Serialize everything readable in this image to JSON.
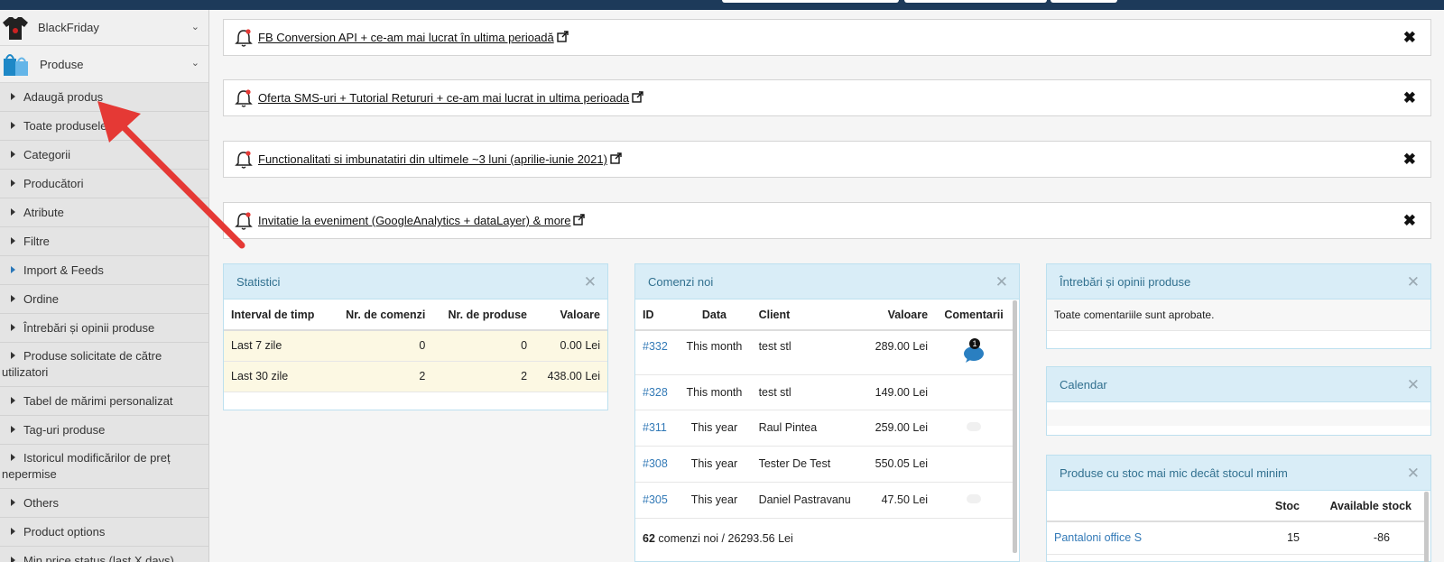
{
  "sidebar": {
    "menus": [
      {
        "label": "BlackFriday"
      },
      {
        "label": "Produse"
      }
    ],
    "items": [
      {
        "label": "Adaugă produs"
      },
      {
        "label": "Toate produsele"
      },
      {
        "label": "Categorii"
      },
      {
        "label": "Producători"
      },
      {
        "label": "Atribute"
      },
      {
        "label": "Filtre"
      },
      {
        "label": "Import & Feeds"
      },
      {
        "label": "Ordine"
      },
      {
        "label": "Întrebări și opinii produse"
      },
      {
        "label": "Produse solicitate de către utilizatori"
      },
      {
        "label": "Tabel de mărimi personalizat"
      },
      {
        "label": "Tag-uri produse"
      },
      {
        "label": "Istoricul modificărilor de preț nepermise"
      },
      {
        "label": "Others"
      },
      {
        "label": "Product options"
      },
      {
        "label": "Min price status (last X days)"
      }
    ]
  },
  "notifications": [
    {
      "text": "FB Conversion API + ce-am mai lucrat în ultima perioadă"
    },
    {
      "text": "Oferta SMS-uri + Tutorial Retururi + ce-am mai lucrat in ultima perioada"
    },
    {
      "text": "Functionalitati si imbunatatiri din ultimele ~3 luni (aprilie-iunie 2021)"
    },
    {
      "text": "Invitatie la eveniment (GoogleAnalytics + dataLayer) & more"
    }
  ],
  "stats": {
    "title": "Statistici",
    "headers": [
      "Interval de timp",
      "Nr. de comenzi",
      "Nr. de produse",
      "Valoare"
    ],
    "rows": [
      {
        "interval": "Last 7 zile",
        "orders": "0",
        "products": "0",
        "value": "0.00 Lei"
      },
      {
        "interval": "Last 30 zile",
        "orders": "2",
        "products": "2",
        "value": "438.00 Lei"
      }
    ]
  },
  "orders": {
    "title": "Comenzi noi",
    "headers": [
      "ID",
      "Data",
      "Client",
      "Valoare",
      "Comentarii"
    ],
    "rows": [
      {
        "id": "#332",
        "date": "This month",
        "client": "test stl",
        "value": "289.00 Lei",
        "comments": "1"
      },
      {
        "id": "#328",
        "date": "This month",
        "client": "test stl",
        "value": "149.00 Lei",
        "comments": ""
      },
      {
        "id": "#311",
        "date": "This year",
        "client": "Raul Pintea",
        "value": "259.00 Lei",
        "comments": ""
      },
      {
        "id": "#308",
        "date": "This year",
        "client": "Tester De Test",
        "value": "550.05 Lei",
        "comments": ""
      },
      {
        "id": "#305",
        "date": "This year",
        "client": "Daniel Pastravanu",
        "value": "47.50 Lei",
        "comments": ""
      }
    ],
    "footer_count": "62",
    "footer_text": " comenzi noi / 26293.56 Lei"
  },
  "questions": {
    "title": "Întrebări și opinii produse",
    "body": "Toate comentariile sunt aprobate."
  },
  "calendar": {
    "title": "Calendar"
  },
  "lowstock": {
    "title": "Produse cu stoc mai mic decât stocul minim",
    "headers": [
      "",
      "Stoc",
      "Available stock"
    ],
    "rows": [
      {
        "name": "Pantaloni office S",
        "stock": "15",
        "available": "-86"
      }
    ]
  },
  "colors": {
    "accent": "#337ab7",
    "panel_header": "#d9edf7",
    "highlight_row": "#fcf8e3",
    "arrow": "#e53935"
  }
}
